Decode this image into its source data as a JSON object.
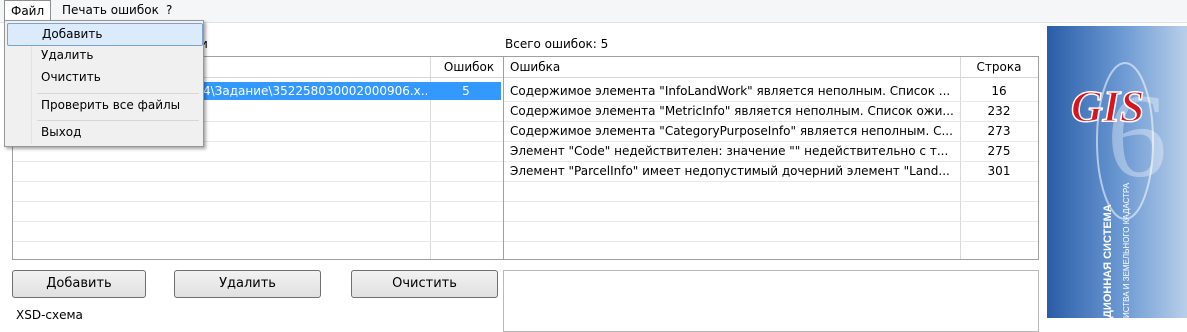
{
  "menubar": {
    "file": "Файл",
    "print_errors": "Печать ошибок",
    "help": "?"
  },
  "file_menu": {
    "add": "Добавить",
    "remove": "Удалить",
    "clear": "Очистить",
    "check_all": "Проверить все файлы",
    "exit": "Выход"
  },
  "left_caption_partial": "и",
  "files_table": {
    "col_errors": "Ошибок",
    "rows": [
      {
        "path": "4\\Задание\\352258030002000906.x...",
        "errors": "5"
      }
    ]
  },
  "errors_summary": "Всего ошибок: 5",
  "errors_table": {
    "col_error": "Ошибка",
    "col_line": "Строка",
    "rows": [
      {
        "text": "Содержимое элемента \"InfoLandWork\" является неполным. Список ...",
        "line": "16"
      },
      {
        "text": "Содержимое элемента \"MetricInfo\" является неполным. Список ожи...",
        "line": "232"
      },
      {
        "text": "Содержимое элемента \"CategoryPurposeInfo\" является неполным. С...",
        "line": "273"
      },
      {
        "text": "Элемент \"Code\" недействителен: значение \"\" недействительно с т...",
        "line": "275"
      },
      {
        "text": "Элемент \"ParcelInfo\" имеет недопустимый дочерний элемент \"Land...",
        "line": "301"
      }
    ]
  },
  "buttons": {
    "add": "Добавить",
    "remove": "Удалить",
    "clear": "Очистить"
  },
  "xsd_label": "XSD-схема",
  "logo": {
    "gis": "GIS",
    "six": "6",
    "line1": "ДИОННАЯ СИСТЕМА",
    "line2": "ИСТВА И ЗЕМЕЛЬНОГО КАДАСТРА"
  },
  "colors": {
    "selection": "#3399ff",
    "logo_red": "#d8141c",
    "logo_blue": "#2a5da8"
  }
}
